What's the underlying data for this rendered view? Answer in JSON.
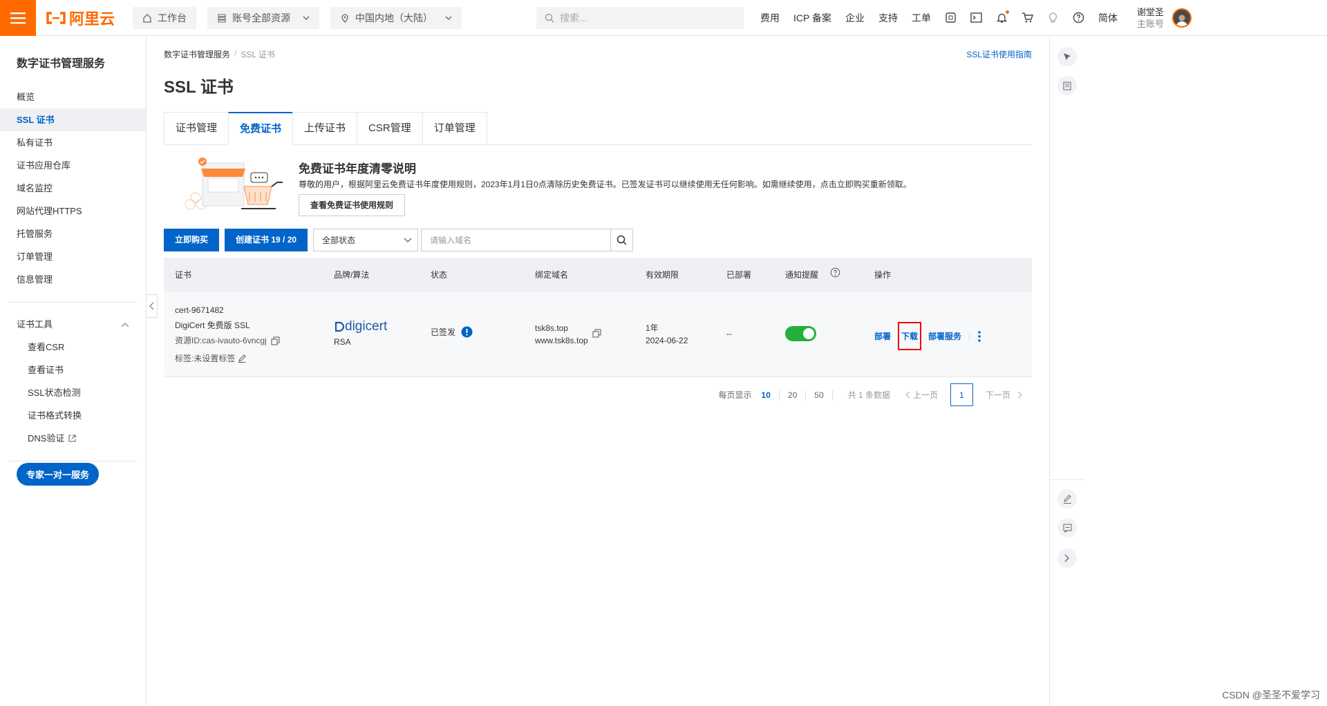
{
  "topbar": {
    "logo_text": "阿里云",
    "workbench": "工作台",
    "resources": "账号全部资源",
    "region": "中国内地（大陆）",
    "search_placeholder": "搜索...",
    "links": [
      "费用",
      "ICP 备案",
      "企业",
      "支持",
      "工单"
    ],
    "lang": "简体",
    "user_name": "谢堂圣",
    "user_role": "主账号",
    "brand_color": "#ff6a00"
  },
  "sidebar": {
    "title": "数字证书管理服务",
    "items": [
      "概览",
      "SSL 证书",
      "私有证书",
      "证书应用仓库",
      "域名监控",
      "网站代理HTTPS",
      "托管服务",
      "订单管理",
      "信息管理"
    ],
    "active_index": 1,
    "tools_group": "证书工具",
    "tools": [
      "查看CSR",
      "查看证书",
      "SSL状态检测",
      "证书格式转换",
      "DNS验证"
    ],
    "expert_button": "专家一对一服务"
  },
  "main": {
    "breadcrumb": [
      "数字证书管理服务",
      "/",
      "SSL 证书"
    ],
    "guide_link": "SSL证书使用指南",
    "title": "SSL 证书",
    "tabs": [
      "证书管理",
      "免费证书",
      "上传证书",
      "CSR管理",
      "订单管理"
    ],
    "active_tab": 1,
    "notice_title": "免费证书年度清零说明",
    "notice_text": "尊敬的用户，根据阿里云免费证书年度使用规则，2023年1月1日0点清除历史免费证书。已签发证书可以继续使用无任何影响。如需继续使用，点击立即购买重新领取。",
    "notice_button": "查看免费证书使用规则",
    "buy_button": "立即购买",
    "create_button": "创建证书 19 / 20",
    "status_select": "全部状态",
    "domain_placeholder": "请输入域名",
    "accent_color": "#0064c8"
  },
  "table": {
    "headers": [
      "证书",
      "品牌/算法",
      "状态",
      "绑定域名",
      "有效期限",
      "已部署",
      "通知提醒",
      "操作"
    ],
    "row": {
      "cert_id": "cert-9671482",
      "cert_name": "DigiCert 免费版 SSL",
      "resource_id": "资源ID:cas-ivauto-6vncgj",
      "tag": "标签:未设置标签",
      "brand": "digicert",
      "algo": "RSA",
      "status": "已签发",
      "domains": [
        "tsk8s.top",
        "www.tsk8s.top"
      ],
      "validity": "1年",
      "expires": "2024-06-22",
      "deployed": "--",
      "notify_on": true,
      "actions": [
        "部署",
        "下载",
        "部署服务"
      ]
    }
  },
  "pagination": {
    "per_page_label": "每页显示",
    "sizes": [
      "10",
      "20",
      "50"
    ],
    "total": "共 1 条数据",
    "prev": "上一页",
    "page": "1",
    "next": "下一页"
  },
  "watermark": "CSDN @圣圣不爱学习"
}
